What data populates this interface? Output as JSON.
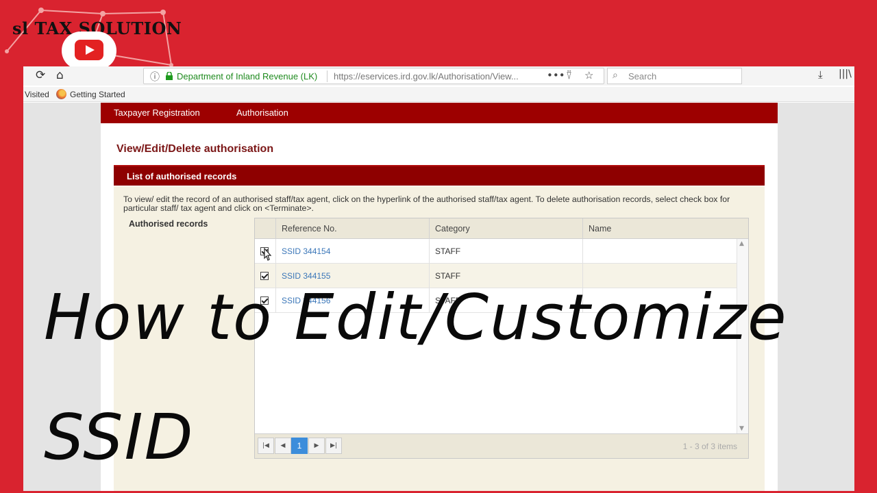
{
  "channel": {
    "name": "sl TAX SOLUTION"
  },
  "browser": {
    "org_label": "Department of Inland Revenue (LK)",
    "url": "https://eservices.ird.gov.lk/Authorisation/View...",
    "search_placeholder": "Search",
    "bookmarks": [
      "Visited",
      "Getting Started"
    ]
  },
  "site": {
    "nav": [
      "Taxpayer Registration",
      "Authorisation"
    ],
    "page_title": "View/Edit/Delete authorisation",
    "section_title": "List of authorised records",
    "instructions": "To view/ edit the record of an authorised staff/tax agent, click on the hyperlink of the authorised staff/tax agent. To delete authorisation records, select check box for particular staff/ tax agent and click on <Terminate>.",
    "records_label": "Authorised records"
  },
  "grid": {
    "columns": [
      "Reference No.",
      "Category",
      "Name"
    ],
    "rows": [
      {
        "reference": "SSID 344154",
        "category": "STAFF",
        "name": "",
        "checked": true
      },
      {
        "reference": "SSID 344155",
        "category": "STAFF",
        "name": "",
        "checked": true
      },
      {
        "reference": "SSID 344156",
        "category": "STAFF",
        "name": "",
        "checked": true
      }
    ],
    "current_page": "1",
    "page_info": "1 - 3 of 3 items"
  },
  "overlay": {
    "line1": "How to Edit/Customize",
    "line2": "SSID"
  },
  "colors": {
    "background": "#d9232f",
    "nav": "#9d0000",
    "section_header": "#8e0000",
    "link": "#3a76b8",
    "pager_active": "#3c8ddb"
  }
}
